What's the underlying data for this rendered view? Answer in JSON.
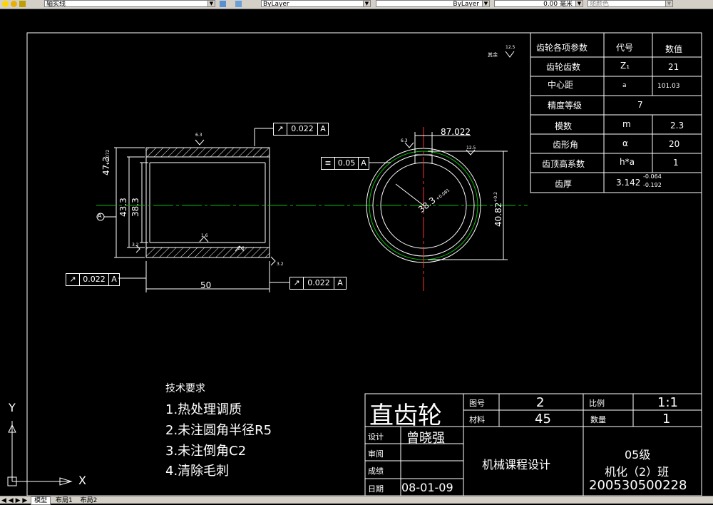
{
  "toolbar": {
    "layer_name": "轴实线",
    "color": "ByLayer",
    "linetype": "ByLayer",
    "lineweight": "0.00 毫米",
    "plotstyle": "随颜色"
  },
  "tabs": [
    "模型",
    "布局1",
    "布局2"
  ],
  "dims": {
    "od_tol": "47.3",
    "od_tol_sup": "+0.072",
    "od": "43.3",
    "id": "38.3",
    "len": "50",
    "key_w": "87.022",
    "bore": "38.3",
    "bore_tol": "+0.081",
    "bore_tol2": "-0",
    "outer_right": "40.82",
    "outer_right_tol": "+0.2",
    "datum": "A"
  },
  "gdt": {
    "f1_val": "0.022",
    "f1_ref": "A",
    "f2_val": "0.05",
    "f2_ref": "A",
    "f3_val": "0.022",
    "f3_ref": "A",
    "f4_val": "0.022",
    "f4_ref": "A"
  },
  "roughness": {
    "r1": "6.3",
    "r2": "12.5",
    "r3": "1.6",
    "r4": "1.6",
    "r5": "6.3",
    "r6": "12.5",
    "r7": "3.2",
    "r8": "3.2",
    "rest_label": "其余"
  },
  "param_table": {
    "headers": [
      "齿轮各项参数",
      "代号",
      "数值"
    ],
    "rows": [
      {
        "name": "齿轮齿数",
        "sym": "Z₁",
        "val": "21"
      },
      {
        "name": "中心距",
        "sym": "a",
        "val": "101.03"
      },
      {
        "name": "精度等级",
        "sym": "",
        "val": "7"
      },
      {
        "name": "模数",
        "sym": "m",
        "val": "2.3"
      },
      {
        "name": "齿形角",
        "sym": "α",
        "val": "20"
      },
      {
        "name": "齿顶高系数",
        "sym": "h*a",
        "val": "1"
      },
      {
        "name": "齿厚",
        "sym": "",
        "val": "3.142",
        "tol_up": "-0.064",
        "tol_lo": "-0.192"
      }
    ]
  },
  "notes": {
    "title": "技术要求",
    "items": [
      "1.热处理调质",
      "2.未注圆角半径R5",
      "3.未注倒角C2",
      "4.清除毛刺"
    ]
  },
  "title_block": {
    "part_name": "直齿轮",
    "drawing_no_label": "图号",
    "drawing_no": "2",
    "scale_label": "比例",
    "scale": "1:1",
    "material_label": "材料",
    "material": "45",
    "qty_label": "数量",
    "qty": "1",
    "design_label": "设计",
    "designer": "曾晓强",
    "review_label": "审阅",
    "score_label": "成绩",
    "date_label": "日期",
    "date": "08-01-09",
    "course": "机械课程设计",
    "grade": "05级",
    "class": "机化（2）班",
    "student_id": "200530500228"
  },
  "ucs": {
    "y": "Y",
    "x": "X"
  }
}
